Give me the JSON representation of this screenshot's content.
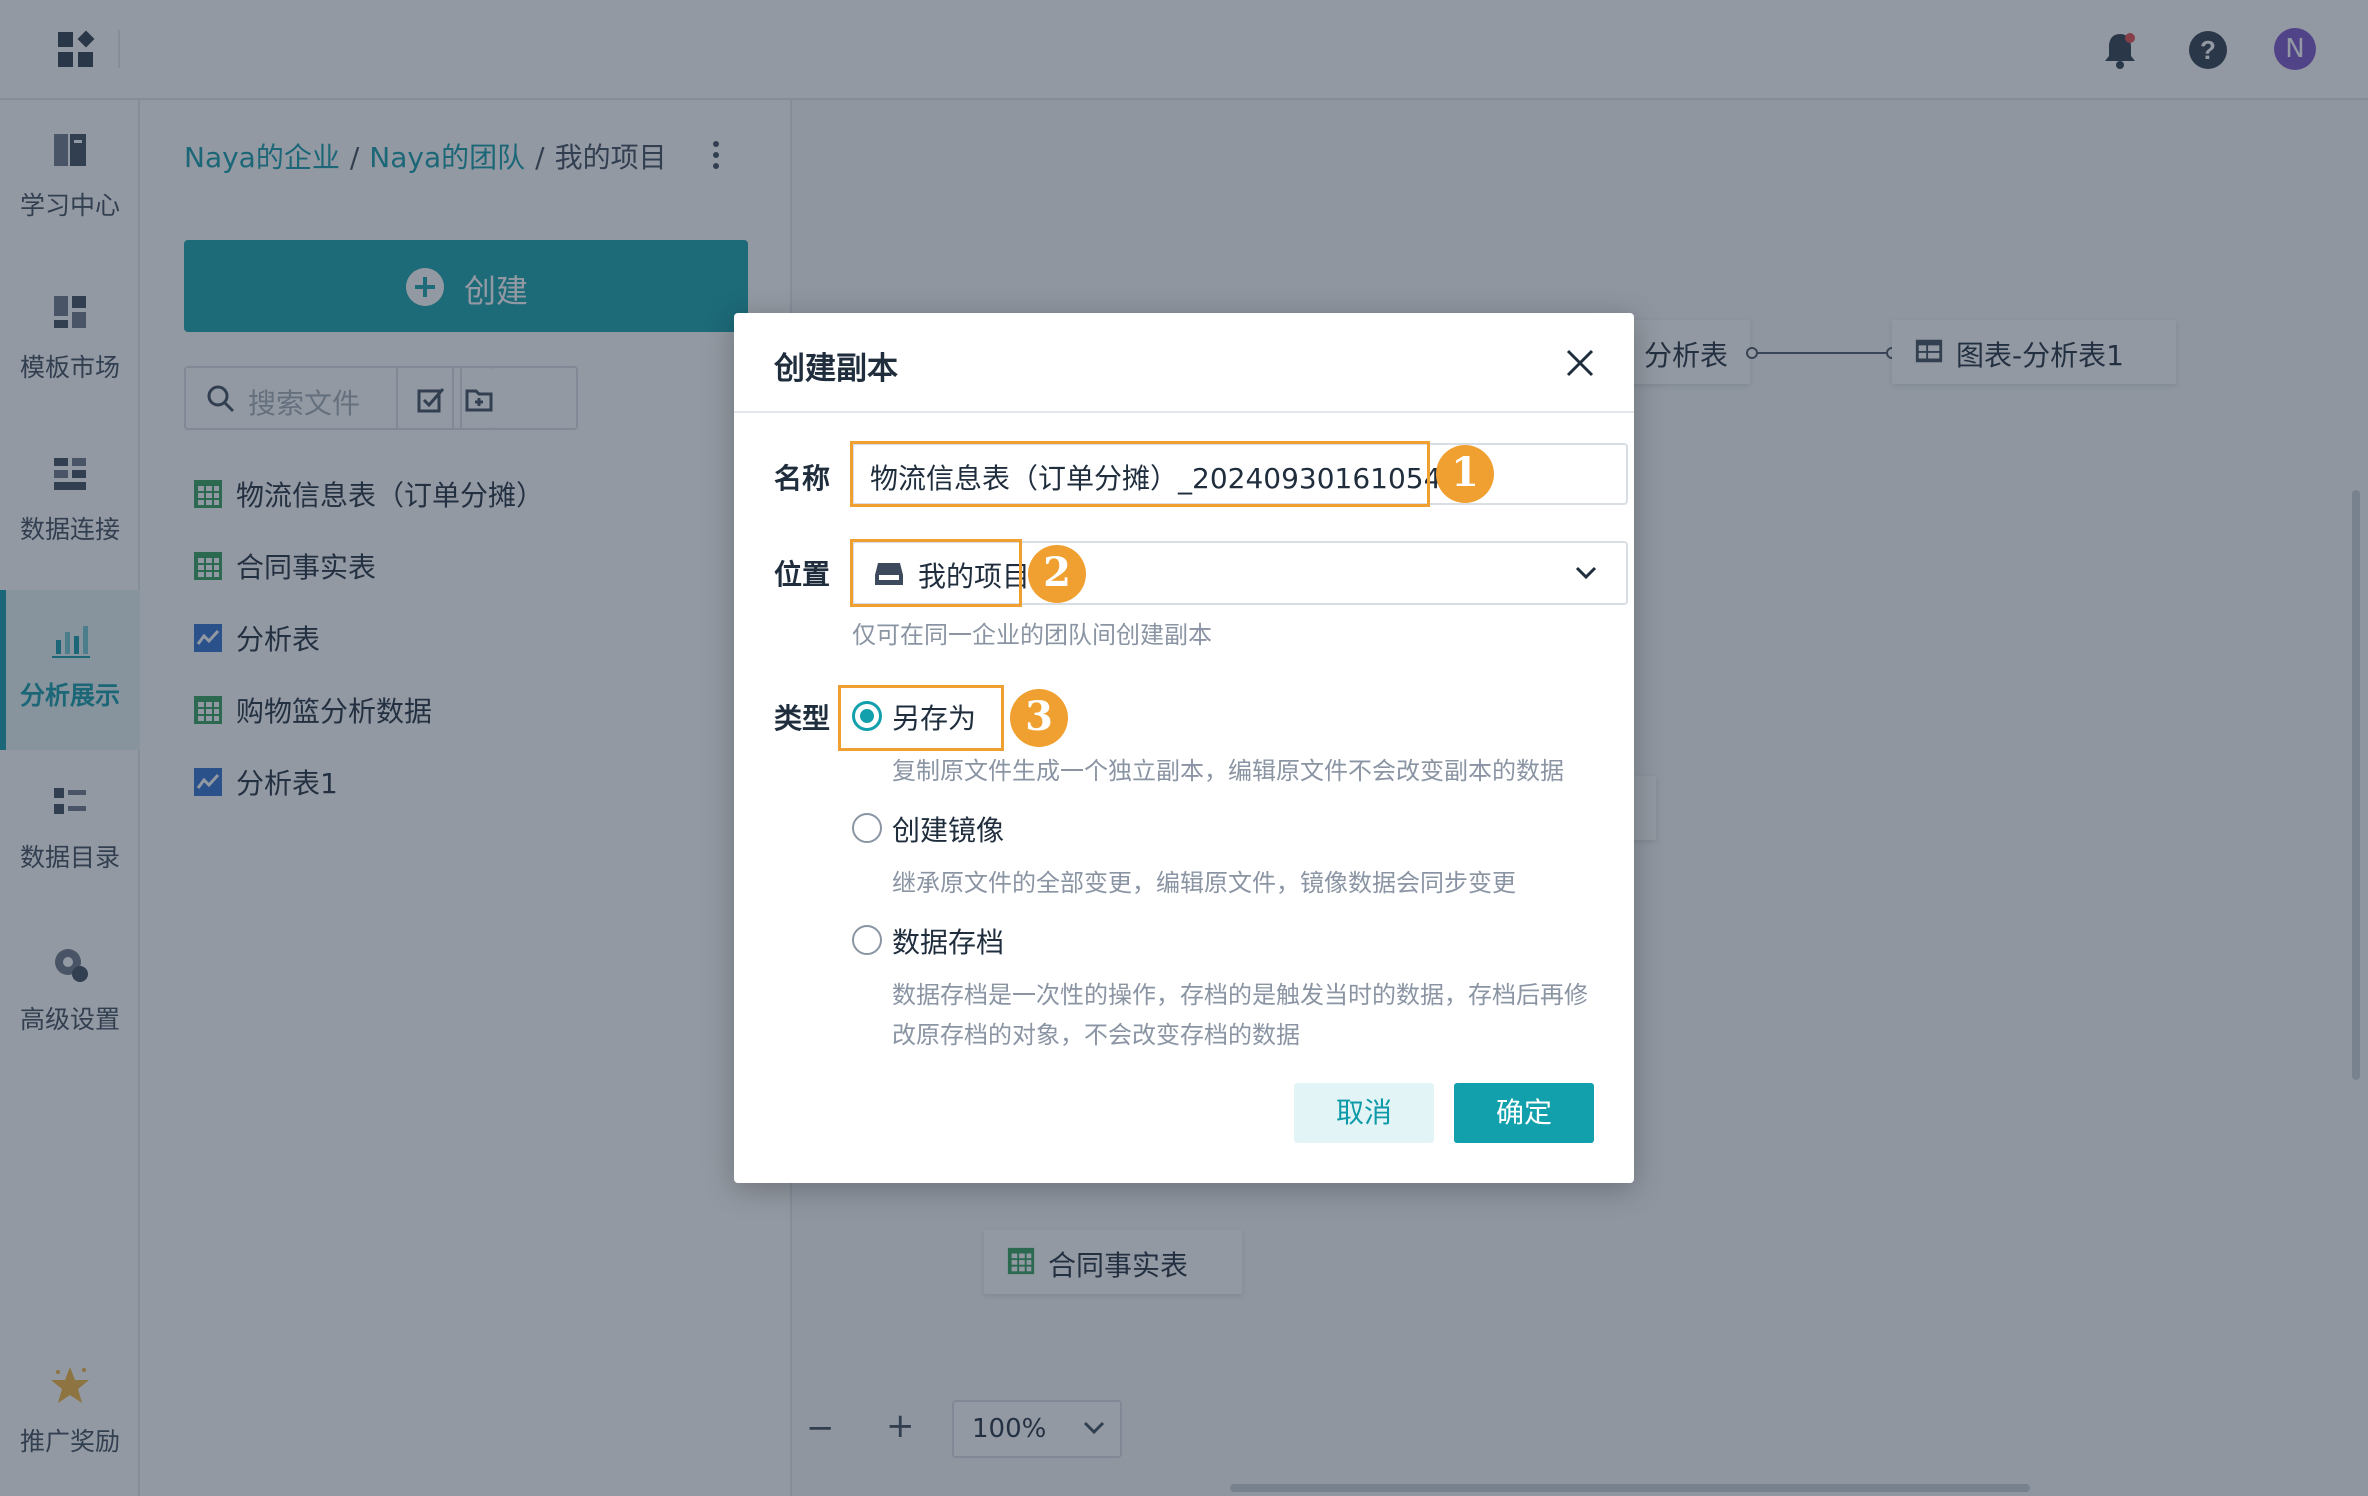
{
  "topbar": {
    "avatar_initial": "N",
    "icons": [
      "apps-grid-icon",
      "bell-icon",
      "help-icon"
    ]
  },
  "nav": {
    "items": [
      {
        "label": "学习中心",
        "icon": "book-icon"
      },
      {
        "label": "模板市场",
        "icon": "template-icon"
      },
      {
        "label": "数据连接",
        "icon": "data-connection-icon"
      },
      {
        "label": "分析展示",
        "icon": "chart-icon",
        "active": true
      },
      {
        "label": "数据目录",
        "icon": "catalog-icon"
      },
      {
        "label": "高级设置",
        "icon": "gear-icon"
      },
      {
        "label": "推广奖励",
        "icon": "star-icon"
      }
    ]
  },
  "filepanel": {
    "breadcrumb": [
      "Naya的企业",
      "Naya的团队",
      "我的项目"
    ],
    "breadcrumb_sep": "/",
    "create_label": "创建",
    "search_placeholder": "搜索文件",
    "files": [
      {
        "label": "物流信息表（订单分摊）",
        "icon": "table-icon"
      },
      {
        "label": "合同事实表",
        "icon": "table-icon"
      },
      {
        "label": "分析表",
        "icon": "analysis-icon"
      },
      {
        "label": "购物篮分析数据",
        "icon": "table-icon"
      },
      {
        "label": "分析表1",
        "icon": "analysis-icon"
      }
    ]
  },
  "canvas": {
    "nodes": [
      "分析表",
      "图表-分析表1",
      "合同事实表"
    ],
    "zoom": "100%",
    "zoom_minus": "−",
    "zoom_plus": "+"
  },
  "dialog": {
    "title": "创建副本",
    "name_label": "名称",
    "name_value": "物流信息表（订单分摊）_20240930161054",
    "location_label": "位置",
    "location_value": "我的项目",
    "location_hint": "仅可在同一企业的团队间创建副本",
    "type_label": "类型",
    "types": [
      {
        "label": "另存为",
        "desc": "复制原文件生成一个独立副本，编辑原文件不会改变副本的数据",
        "checked": true
      },
      {
        "label": "创建镜像",
        "desc": "继承原文件的全部变更，编辑原文件，镜像数据会同步变更",
        "checked": false
      },
      {
        "label": "数据存档",
        "desc": "数据存档是一次性的操作，存档的是触发当时的数据，存档后再修",
        "desc2": "改原存档的对象，不会改变存档的数据",
        "checked": false
      }
    ],
    "cancel_label": "取消",
    "ok_label": "确定"
  },
  "annotations": [
    "1",
    "2",
    "3"
  ],
  "colors": {
    "accent": "#12a0ad",
    "highlight": "#f0a030",
    "overlay": "rgba(40,52,70,0.5)"
  }
}
